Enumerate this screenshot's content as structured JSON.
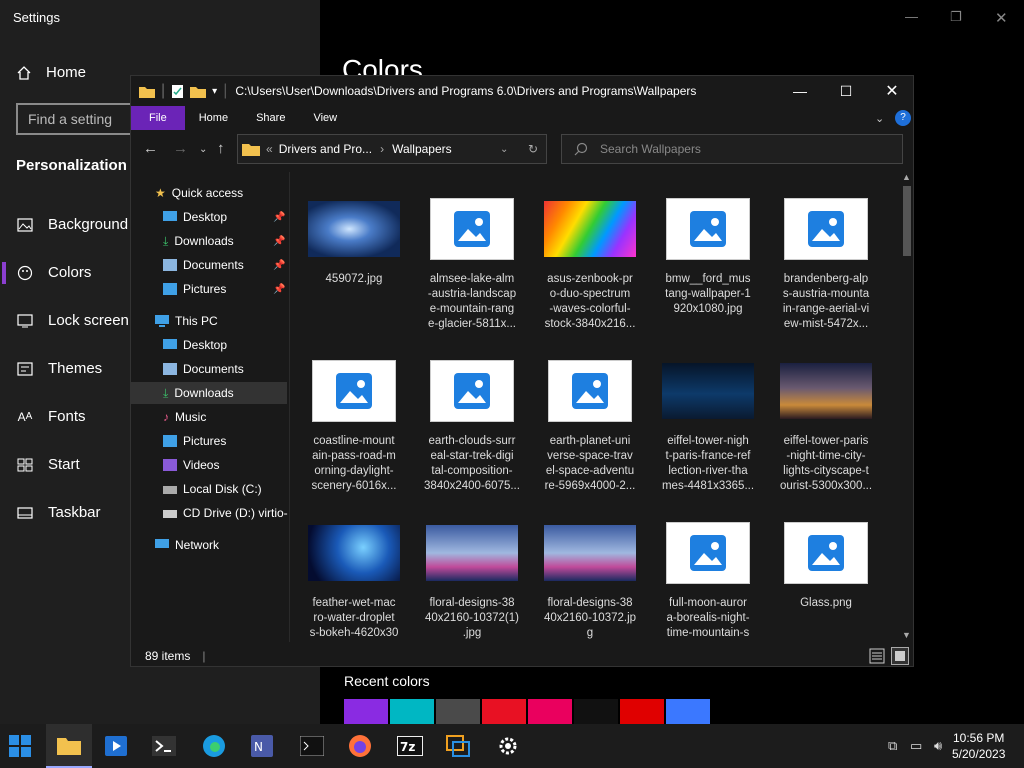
{
  "settings": {
    "title": "Settings",
    "home": "Home",
    "find_placeholder": "Find a setting",
    "section": "Personalization",
    "nav": [
      "Background",
      "Colors",
      "Lock screen",
      "Themes",
      "Fonts",
      "Start",
      "Taskbar"
    ],
    "page_title": "Colors",
    "recent_colors_label": "Recent colors",
    "recent_colors": [
      "#8a2be2",
      "#00b7c3",
      "#4a4a4a",
      "#e81123",
      "#ea005e",
      "#111111",
      "#e00000",
      "#3b78ff"
    ]
  },
  "explorer": {
    "path": "C:\\Users\\User\\Downloads\\Drivers and Programs 6.0\\Drivers and Programs\\Wallpapers",
    "ribbon": [
      "File",
      "Home",
      "Share",
      "View"
    ],
    "addr_prefix": "«",
    "addr_parent": "Drivers and Pro...",
    "addr_current": "Wallpapers",
    "search_placeholder": "Search Wallpapers",
    "tree": {
      "quick_access": "Quick access",
      "qa_items": [
        "Desktop",
        "Downloads",
        "Documents",
        "Pictures"
      ],
      "this_pc": "This PC",
      "pc_items": [
        "Desktop",
        "Documents",
        "Downloads",
        "Music",
        "Pictures",
        "Videos",
        "Local Disk (C:)",
        "CD Drive (D:) virtio-"
      ],
      "network": "Network"
    },
    "files": [
      {
        "name": "459072.jpg",
        "kind": "photo"
      },
      {
        "name": "almsee-lake-alm\n-austria-landscap\ne-mountain-rang\ne-glacier-5811x...",
        "kind": "icon"
      },
      {
        "name": "asus-zenbook-pr\no-duo-spectrum\n-waves-colorful-\nstock-3840x216...",
        "kind": "photo"
      },
      {
        "name": "bmw__ford_mus\ntang-wallpaper-1\n920x1080.jpg",
        "kind": "icon"
      },
      {
        "name": "brandenberg-alp\ns-austria-mounta\nin-range-aerial-vi\new-mist-5472x...",
        "kind": "icon"
      },
      {
        "name": "coastline-mount\nain-pass-road-m\norning-daylight-\nscenery-6016x...",
        "kind": "icon"
      },
      {
        "name": "earth-clouds-surr\neal-star-trek-digi\ntal-composition-\n3840x2400-6075...",
        "kind": "icon"
      },
      {
        "name": "earth-planet-uni\nverse-space-trav\nel-space-adventu\nre-5969x4000-2...",
        "kind": "icon"
      },
      {
        "name": "eiffel-tower-nigh\nt-paris-france-ref\nlection-river-tha\nmes-4481x3365...",
        "kind": "photo"
      },
      {
        "name": "eiffel-tower-paris\n-night-time-city-\nlights-cityscape-t\nourist-5300x300...",
        "kind": "photo"
      },
      {
        "name": "feather-wet-mac\nro-water-droplet\ns-bokeh-4620x30",
        "kind": "photo"
      },
      {
        "name": "floral-designs-38\n40x2160-10372(1)\n.jpg",
        "kind": "photo"
      },
      {
        "name": "floral-designs-38\n40x2160-10372.jp\ng",
        "kind": "photo"
      },
      {
        "name": "full-moon-auror\na-borealis-night-\ntime-mountain-s",
        "kind": "icon"
      },
      {
        "name": "Glass.png",
        "kind": "icon"
      }
    ],
    "status": "89 items"
  },
  "taskbar": {
    "time": "10:56 PM",
    "date": "5/20/2023"
  },
  "colors": {
    "accent": "#6b24b7",
    "file_tab": "#6b24b7",
    "highlight": "#8b3fd0"
  }
}
